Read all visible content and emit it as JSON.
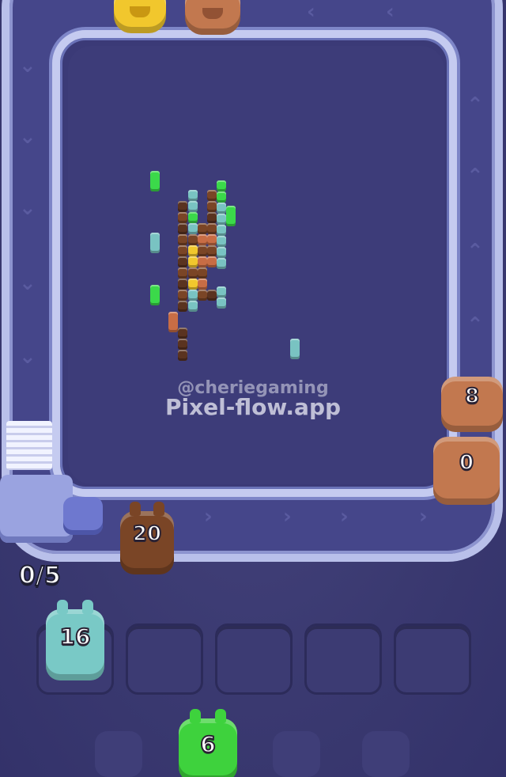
{
  "watermark": {
    "handle": "@cheriegaming",
    "site": "Pixel-flow.app"
  },
  "counter": "0/5",
  "conveyor_shooter": {
    "value": "20",
    "color": "#7a4526"
  },
  "right_creatures": [
    {
      "value": "8",
      "color": "#c2784f"
    },
    {
      "value": "0",
      "color": "#c2784f"
    }
  ],
  "top_creatures": [
    {
      "value": "",
      "color": "#f1c72d"
    },
    {
      "value": "",
      "color": "#c2784f"
    }
  ],
  "slots": [
    {
      "value": "16",
      "color": "#79c9c6",
      "filled": true
    },
    {
      "value": "",
      "filled": false
    },
    {
      "value": "",
      "filled": false
    },
    {
      "value": "",
      "filled": false
    },
    {
      "value": "",
      "filled": false
    }
  ],
  "queue_next": {
    "value": "6",
    "color": "#3ed23d"
  },
  "colors": {
    "background": "#3a3970",
    "rail": "#b9c0ea",
    "green": "#3bd94a",
    "teal": "#79c3c2",
    "brown": "#7a4526",
    "copper": "#c86d45",
    "yellow": "#f1c72d"
  }
}
